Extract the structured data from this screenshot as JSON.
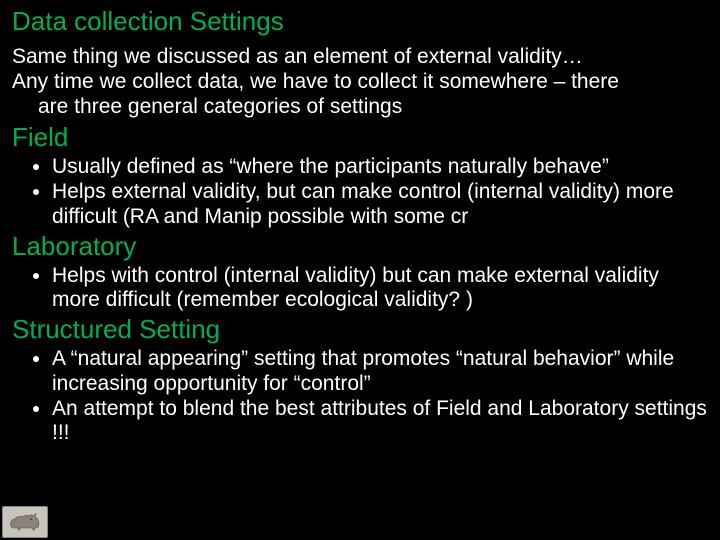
{
  "title": "Data collection Settings",
  "intro": {
    "line1": "Same thing we discussed as an element of external validity…",
    "line2a": "Any time we collect data, we have to collect it somewhere – there",
    "line2b": "are three general categories of settings"
  },
  "sections": [
    {
      "heading": "Field",
      "bullets": [
        "Usually defined as “where the participants naturally behave”",
        "Helps external validity,  but can make control (internal validity) more difficult (RA and Manip possible with some cr"
      ]
    },
    {
      "heading": "Laboratory",
      "bullets": [
        "Helps with control (internal validity) but can make external validity more difficult (remember ecological validity? )"
      ]
    },
    {
      "heading": "Structured Setting",
      "bullets": [
        "A “natural appearing” setting that promotes “natural behavior” while increasing opportunity for “control”",
        "An attempt to blend the best attributes of Field and Laboratory settings !!!"
      ]
    }
  ]
}
